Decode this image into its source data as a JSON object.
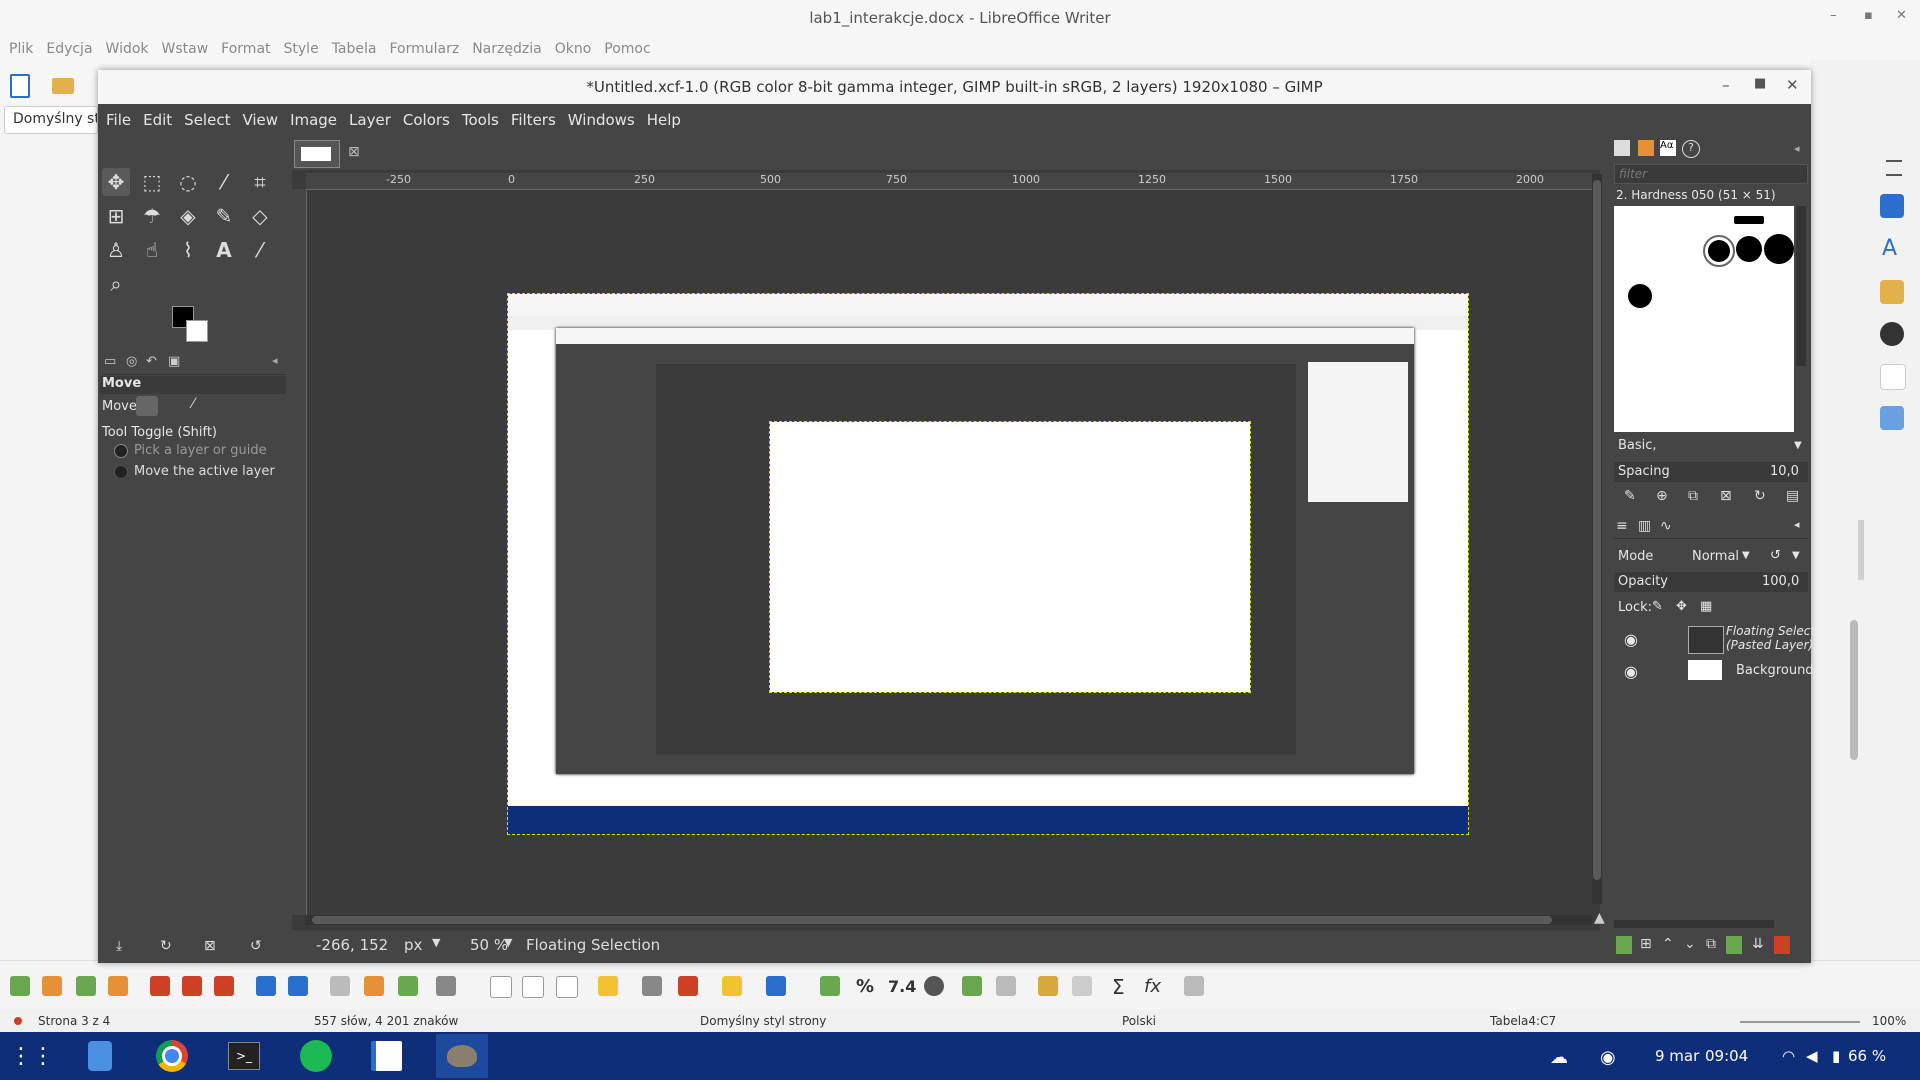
{
  "libreoffice": {
    "title": "lab1_interakcje.docx - LibreOffice Writer",
    "menu": [
      "Plik",
      "Edycja",
      "Widok",
      "Wstaw",
      "Format",
      "Style",
      "Tabela",
      "Formularz",
      "Narzędzia",
      "Okno",
      "Pomoc"
    ],
    "paragraph_style": "Domyślny sty",
    "status": {
      "page": "Strona 3 z 4",
      "words": "557 słów, 4 201 znaków",
      "page_style": "Domyślny styl strony",
      "language": "Polski",
      "cell": "Tabela4:C7",
      "zoom": "100%"
    },
    "bottom_toolbar": {
      "percent": "%",
      "decimal": "7.4",
      "sum": "Σ",
      "fx": "fx"
    }
  },
  "gimp": {
    "title": "*Untitled.xcf-1.0 (RGB color 8-bit gamma integer, GIMP built-in sRGB, 2 layers) 1920x1080 – GIMP",
    "menu": [
      "File",
      "Edit",
      "Select",
      "View",
      "Image",
      "Layer",
      "Colors",
      "Tools",
      "Filters",
      "Windows",
      "Help"
    ],
    "tool_options": {
      "title": "Move",
      "move_label": "Move:",
      "toggle_label": "Tool Toggle  (Shift)",
      "option1": "Pick a layer or guide",
      "option2": "Move the active layer"
    },
    "ruler_labels": [
      "-250",
      "0",
      "250",
      "500",
      "750",
      "1000",
      "1250",
      "1500",
      "1750",
      "2000"
    ],
    "status": {
      "coords": "-266, 152",
      "unit": "px",
      "zoom": "50 %",
      "message": "Floating Selection"
    },
    "brushes": {
      "filter_placeholder": "filter",
      "current": "2. Hardness 050 (51 × 51)",
      "preset": "Basic,",
      "spacing_label": "Spacing",
      "spacing_value": "10,0"
    },
    "layers": {
      "mode_label": "Mode",
      "mode_value": "Normal",
      "opacity_label": "Opacity",
      "opacity_value": "100,0",
      "lock_label": "Lock:",
      "items": [
        {
          "name": "Floating Select\n(Pasted Layer)"
        },
        {
          "name": "Background"
        }
      ]
    }
  },
  "taskbar": {
    "date": "9 mar",
    "time": "09:04",
    "battery": "66 %"
  }
}
